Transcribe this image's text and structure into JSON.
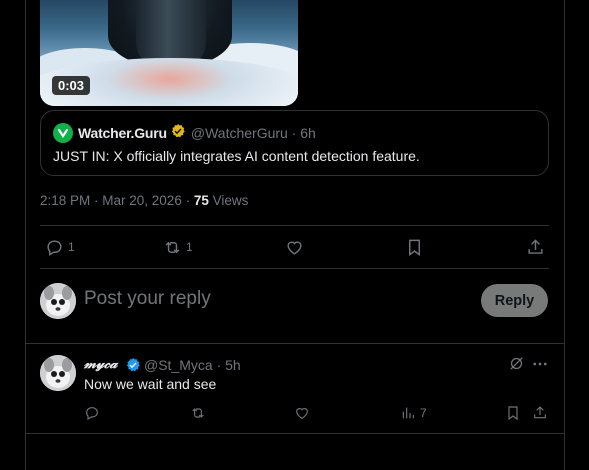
{
  "video": {
    "duration": "0:03"
  },
  "quote": {
    "name": "Watcher.Guru",
    "handle_time": "@WatcherGuru · 6h",
    "text": "JUST IN: X officially integrates AI content detection feature."
  },
  "meta": {
    "timestamp": "2:18 PM · Mar 20, 2026 · ",
    "views_count": "75",
    "views_label": " Views"
  },
  "actions": {
    "replies": "1",
    "reposts": "1"
  },
  "composer": {
    "placeholder": "Post your reply",
    "reply_label": "Reply"
  },
  "reply_post": {
    "name": "𝓂𝓎𝒸𝒶",
    "handle_time": "@St_Myca · 5h",
    "text": "Now we wait and see",
    "views": "7"
  },
  "colors": {
    "background": "#000000",
    "border": "#2f3336",
    "muted": "#71767b",
    "verified_blue": "#1d9bf0",
    "verified_gold": "#e2b719",
    "logo_green": "#11b04b"
  },
  "icons": [
    "reply-icon",
    "repost-icon",
    "like-icon",
    "bookmark-icon",
    "share-icon",
    "views-icon",
    "grok-icon",
    "more-icon",
    "verified-badge-icon"
  ]
}
